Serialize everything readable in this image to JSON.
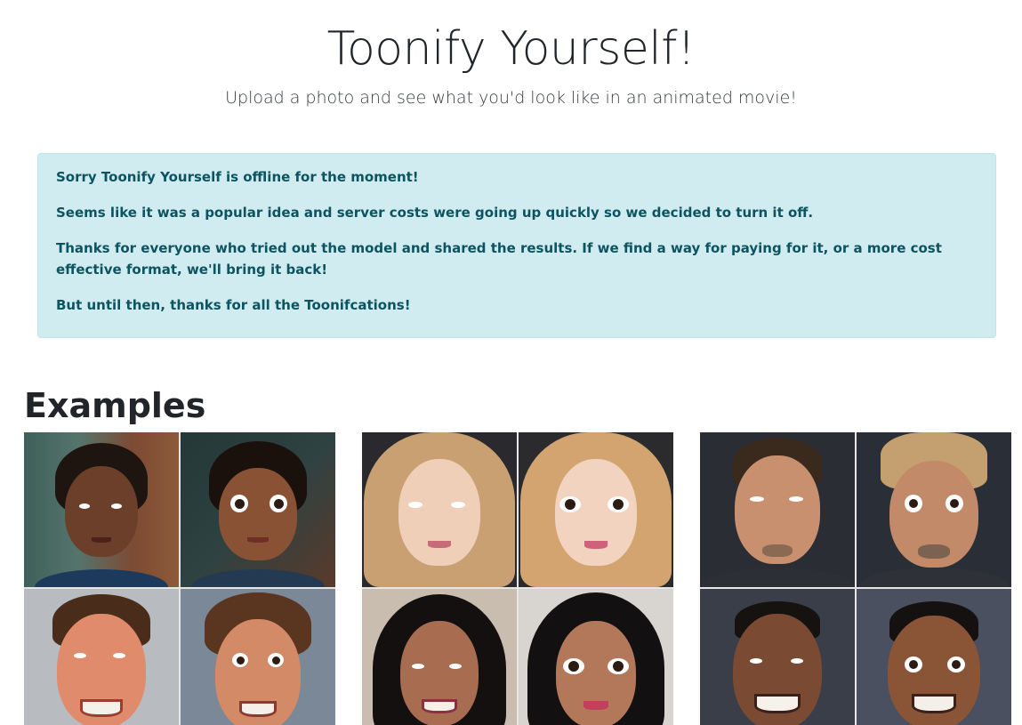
{
  "header": {
    "title": "Toonify Yourself!",
    "subtitle": "Upload a photo and see what you'd look like in an animated movie!"
  },
  "alert": {
    "paragraphs": [
      "Sorry Toonify Yourself is offline for the moment!",
      "Seems like it was a popular idea and server costs were going up quickly so we decided to turn it off.",
      "Thanks for everyone who tried out the model and shared the results. If we find a way for paying for it, or a more cost effective format, we'll bring it back!",
      "But until then, thanks for all the Toonifcations!"
    ],
    "colors": {
      "background": "#d1ecf1",
      "border": "#bee5eb",
      "text": "#0c5460"
    }
  },
  "examples": {
    "heading": "Examples",
    "grids": [
      {
        "pairs": [
          {
            "photo": "woman-short-curly-hair-photo",
            "toon": "woman-short-curly-hair-toon"
          },
          {
            "photo": "smiling-man-brown-hair-photo",
            "toon": "smiling-man-brown-hair-toon"
          }
        ]
      },
      {
        "pairs": [
          {
            "photo": "blonde-woman-wavy-hair-photo",
            "toon": "blonde-woman-wavy-hair-toon"
          },
          {
            "photo": "woman-black-bob-hair-photo",
            "toon": "woman-black-bob-hair-toon"
          }
        ]
      },
      {
        "pairs": [
          {
            "photo": "man-slicked-hair-beard-photo",
            "toon": "man-slicked-hair-beard-toon"
          },
          {
            "photo": "smiling-man-short-hair-photo",
            "toon": "smiling-man-short-hair-toon"
          }
        ]
      }
    ]
  }
}
